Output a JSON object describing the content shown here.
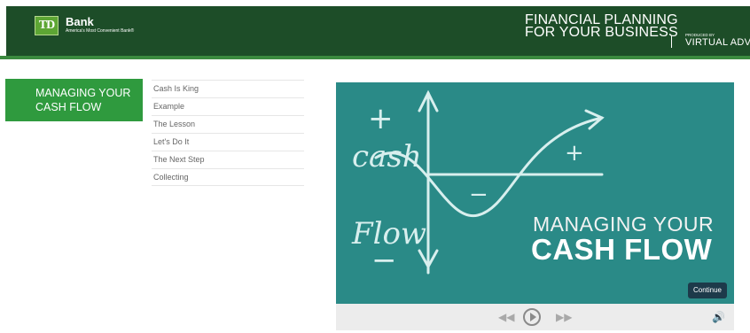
{
  "header": {
    "logo_mark": "TD",
    "logo_name": "Bank",
    "logo_tagline": "America's Most Convenient Bank®",
    "title_line1": "FINANCIAL PLANNING",
    "title_line2": "FOR YOUR BUSINESS",
    "produced_by": "PRODUCED BY",
    "producer": "VIRTUAL ADVIS"
  },
  "section": {
    "title": "MANAGING YOUR CASH FLOW"
  },
  "lessons": [
    "Cash Is King",
    "Example",
    "The Lesson",
    "Let's Do It",
    "The Next Step",
    "Collecting"
  ],
  "player": {
    "slide_title_line1": "MANAGING YOUR",
    "slide_title_line2": "CASH FLOW",
    "board_words": {
      "plus_top": "+",
      "cash": "cash",
      "flow": "Flow",
      "minus_bottom": "−",
      "curve_plus": "+",
      "curve_minus": "−"
    },
    "continue_label": "Continue",
    "controls": {
      "rewind_icon": "rewind-icon",
      "play_icon": "play-icon",
      "forward_icon": "fast-forward-icon",
      "volume_icon": "volume-icon"
    }
  },
  "colors": {
    "header_bg": "#1d4d28",
    "accent_green": "#2f9a3e",
    "board_teal": "#2a8a87",
    "continue_bg": "#1d3a4a"
  }
}
